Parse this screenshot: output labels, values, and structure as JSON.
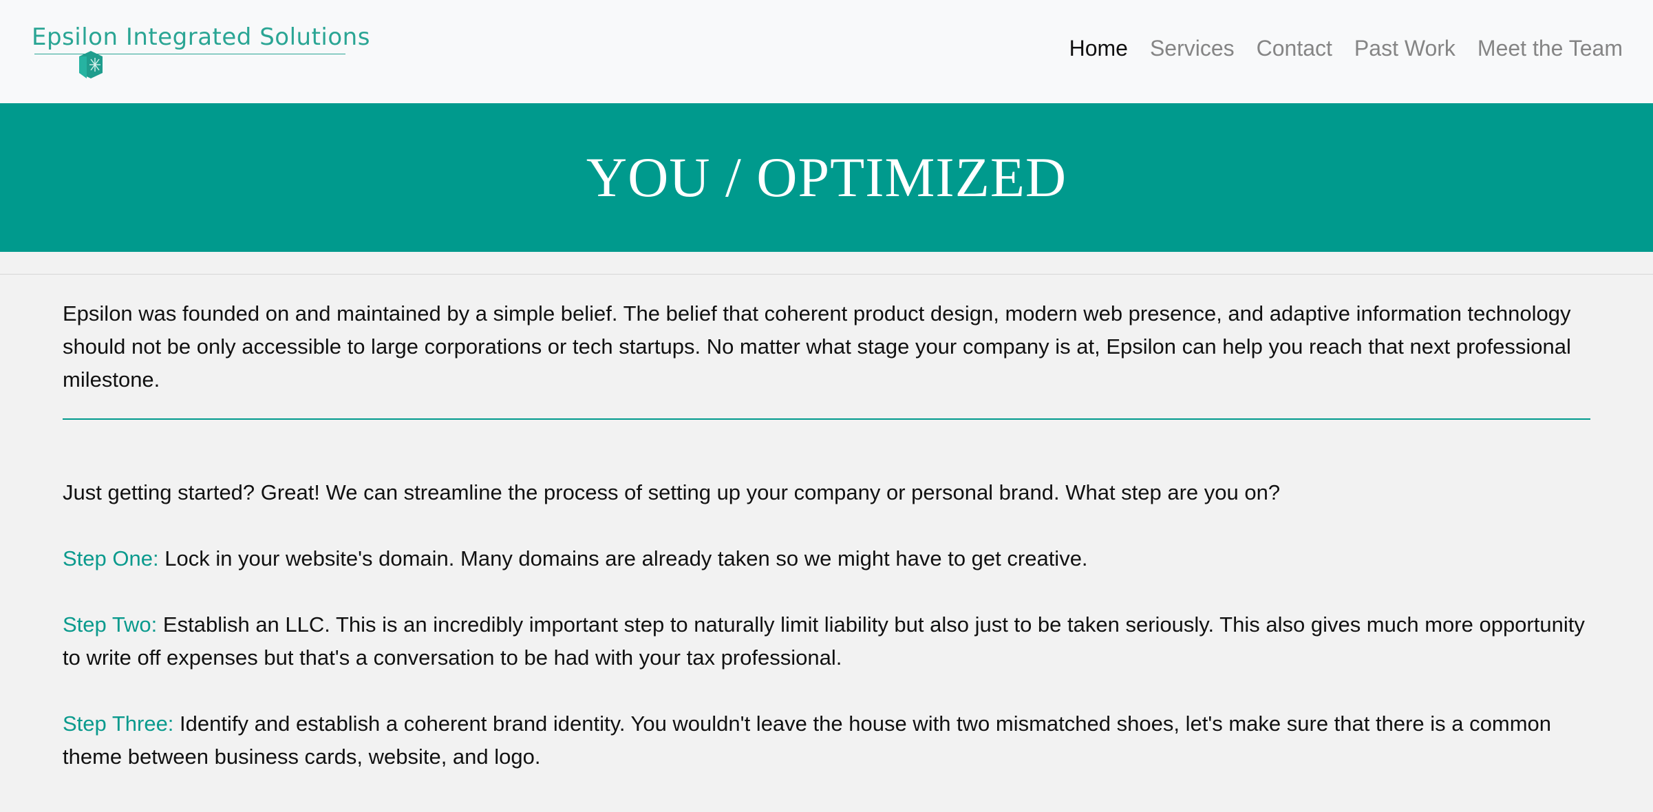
{
  "brand": {
    "name": "Epsilon Integrated Solutions"
  },
  "nav": {
    "items": [
      {
        "label": "Home",
        "active": true
      },
      {
        "label": "Services",
        "active": false
      },
      {
        "label": "Contact",
        "active": false
      },
      {
        "label": "Past Work",
        "active": false
      },
      {
        "label": "Meet the Team",
        "active": false
      }
    ]
  },
  "hero": {
    "title": "YOU / OPTIMIZED"
  },
  "content": {
    "intro": "Epsilon was founded on and maintained by a simple belief. The belief that coherent product design, modern web presence, and adaptive information technology should not be only accessible to large corporations or tech startups. No matter what stage your company is at, Epsilon can help you reach that next professional milestone.",
    "lead": "Just getting started? Great! We can streamline the process of setting up your company or personal brand. What step are you on?",
    "steps": [
      {
        "label": "Step One:",
        "text": "Lock in your website's domain. Many domains are already taken so we might have to get creative."
      },
      {
        "label": "Step Two:",
        "text": "Establish an LLC. This is an incredibly important step to naturally limit liability but also just to be taken seriously. This also gives much more opportunity to write off expenses but that's a conversation to be had with your tax professional."
      },
      {
        "label": "Step Three:",
        "text": "Identify and establish a coherent brand identity. You wouldn't leave the house with two mismatched shoes, let's make sure that there is a common theme between business cards, website, and logo."
      }
    ]
  },
  "colors": {
    "accent": "#009a8d",
    "brand_text": "#2aa594",
    "nav_inactive": "#858585",
    "nav_active": "#111111",
    "page_background": "#f2f2f2",
    "navbar_background": "#f8f9fa"
  },
  "icons": {
    "brand_mark": "hexagon-shield-logo-icon"
  }
}
